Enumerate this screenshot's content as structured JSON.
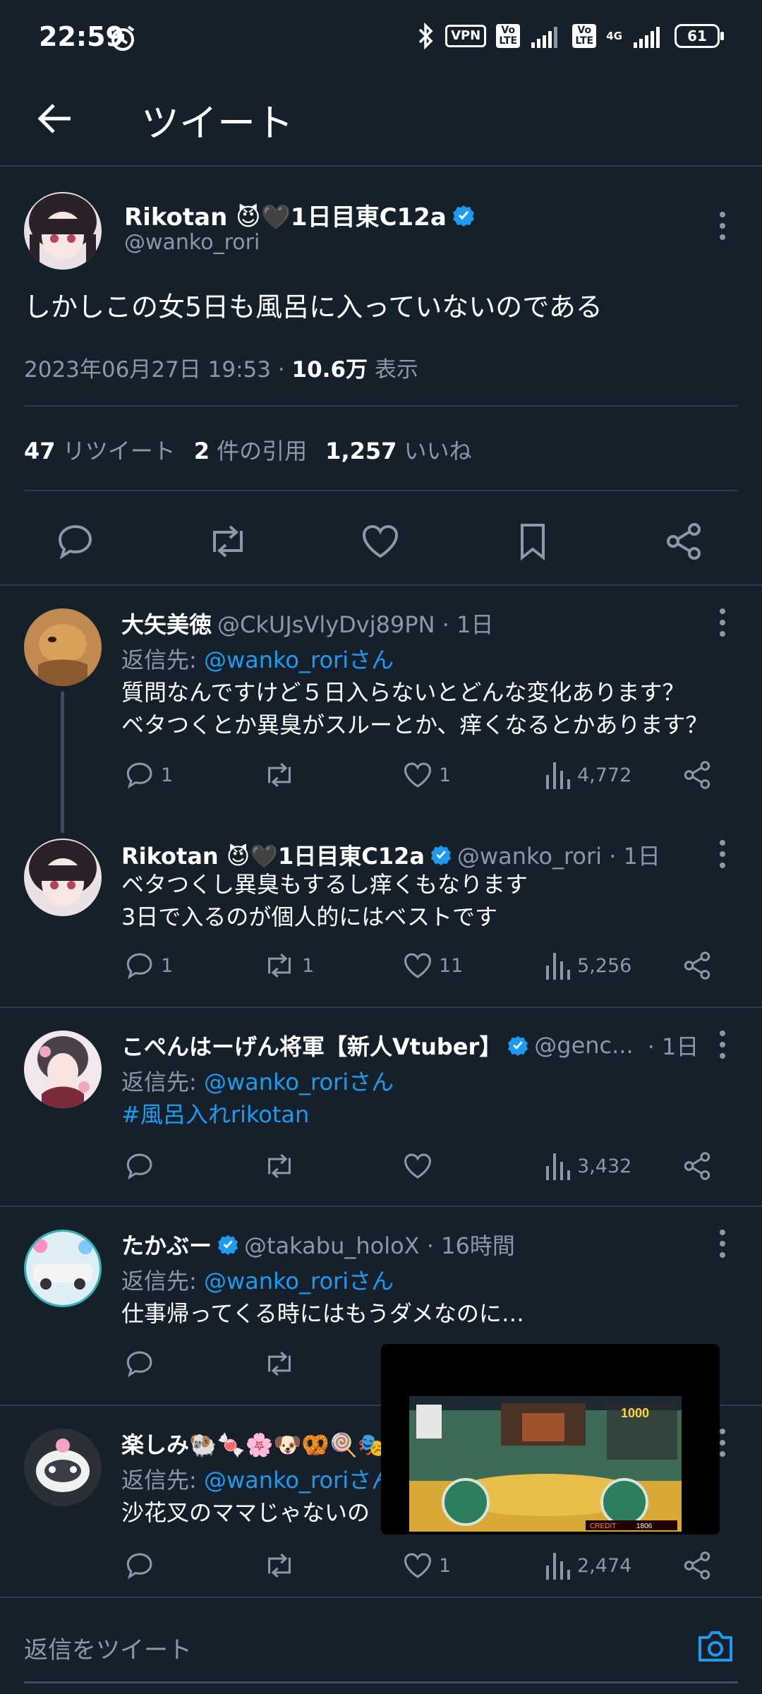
{
  "status_bar": {
    "time": "22:59",
    "vpn": "VPN",
    "volte1": "Vo LTE",
    "volte2": "Vo LTE",
    "network": "4G",
    "battery": "61",
    "icons": [
      "alarm-icon",
      "bluetooth-icon",
      "signal-icon",
      "battery-icon"
    ]
  },
  "header": {
    "title": "ツイート"
  },
  "main_tweet": {
    "name": "Rikotan 😈🖤1日目東C12a",
    "handle": "@wanko_rori",
    "text": "しかしこの女5日も風呂に入っていないのである",
    "date": "2023年06月27日 19:53 · ",
    "views": "10.6万",
    "views_label": " 表示",
    "retweets": "47",
    "retweets_label": "リツイート",
    "quotes": "2",
    "quotes_label": "件の引用",
    "likes": "1,257",
    "likes_label": "いいね"
  },
  "replies": [
    {
      "name": "大矢美徳",
      "handle": "@CkUJsVlyDvj89PN · 1日",
      "reply_to_prefix": "返信先: ",
      "reply_to": "@wanko_roriさん",
      "text1": "質問なんですけど５日入らないとどんな変化あります？",
      "text2": "ベタつくとか異臭がスルーとか、痒くなるとかあります？",
      "comments": "1",
      "retweets": "",
      "likes": "1",
      "views": "4,772"
    },
    {
      "name": "Rikotan 😈🖤1日目東C12a",
      "handle": "@wanko_rori · 1日",
      "text1": "ベタつくし異臭もするし痒くもなります",
      "text2": "3日で入るのが個人的にはベストです",
      "comments": "1",
      "retweets": "1",
      "likes": "11",
      "views": "5,256"
    },
    {
      "name": "こぺんはーげん将軍【新人Vtuber】",
      "handle": "@genc...",
      "time": "· 1日",
      "reply_to_prefix": "返信先: ",
      "reply_to": "@wanko_roriさん",
      "hashtag": "#風呂入れrikotan",
      "views": "3,432"
    },
    {
      "name": "たかぶー",
      "handle": "@takabu_holoX · 16時間",
      "reply_to_prefix": "返信先: ",
      "reply_to": "@wanko_roriさん",
      "text1": "仕事帰ってくる時にはもうダメなのに…"
    },
    {
      "name": "楽しみ🐏🍬🌸🐶🥨🍭🎭",
      "reply_to_prefix": "返信先: ",
      "reply_to": "@wanko_roriさん",
      "text1": "沙花叉のママじゃないの",
      "likes": "1",
      "views": "2,474"
    }
  ],
  "video_overlay": {
    "credit_label": "CREDIT",
    "credit_value": "1806"
  },
  "composer": {
    "placeholder": "返信をツイート"
  },
  "colors": {
    "background": "#15202b",
    "accent": "#1d9bf0",
    "muted": "#8b98a5",
    "divider": "#2f3b47"
  }
}
